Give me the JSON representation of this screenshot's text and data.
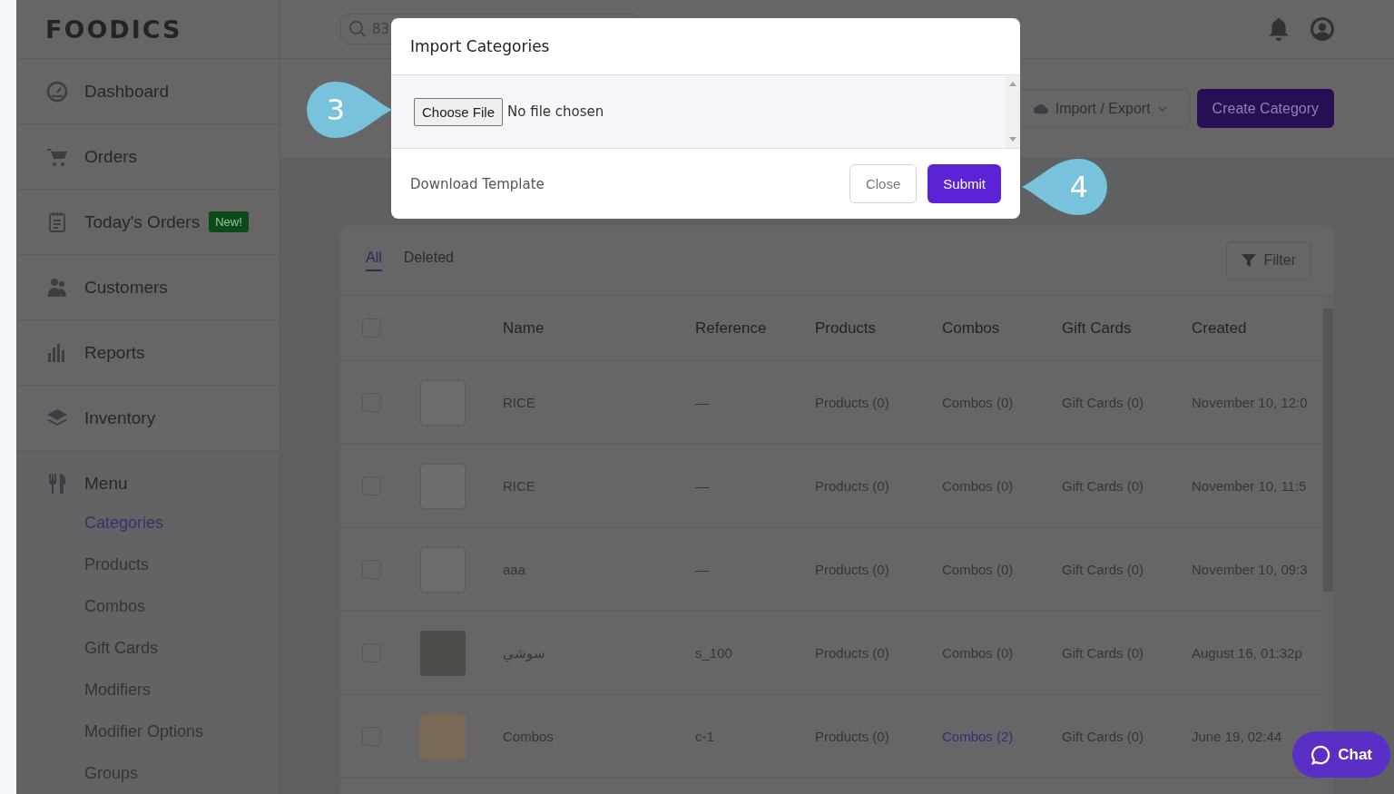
{
  "header": {
    "logo": "FOODICS",
    "search": {
      "value": "83"
    }
  },
  "sidebar": {
    "items": [
      {
        "kind": "dashboard",
        "label": "Dashboard"
      },
      {
        "kind": "orders",
        "label": "Orders"
      },
      {
        "kind": "today",
        "label": "Today's Orders",
        "badge": "New!"
      },
      {
        "kind": "customers",
        "label": "Customers"
      },
      {
        "kind": "reports",
        "label": "Reports"
      },
      {
        "kind": "inventory",
        "label": "Inventory"
      }
    ],
    "menu": {
      "label": "Menu",
      "children": [
        {
          "label": "Categories",
          "selected": true
        },
        {
          "label": "Products",
          "selected": false
        },
        {
          "label": "Combos",
          "selected": false
        },
        {
          "label": "Gift Cards",
          "selected": false
        },
        {
          "label": "Modifiers",
          "selected": false
        },
        {
          "label": "Modifier Options",
          "selected": false
        },
        {
          "label": "Groups",
          "selected": false
        }
      ]
    }
  },
  "toolbar": {
    "import_export": "Import / Export",
    "create": "Create Category"
  },
  "tabs": [
    {
      "label": "All",
      "selected": true
    },
    {
      "label": "Deleted",
      "selected": false
    }
  ],
  "filter": "Filter",
  "table": {
    "select_all": {
      "checked": false
    },
    "columns": [
      "Name",
      "Reference",
      "Products",
      "Combos",
      "Gift Cards",
      "Created"
    ],
    "rows": [
      {
        "checked": false,
        "photo": false,
        "name": "RICE",
        "reference": "—",
        "products": {
          "text": "Products (0)",
          "active": false
        },
        "combos": {
          "text": "Combos (0)",
          "active": false
        },
        "gift_cards": {
          "text": "Gift Cards (0)",
          "active": false
        },
        "created": "November 10, 12:0"
      },
      {
        "checked": false,
        "photo": false,
        "name": "RICE",
        "reference": "—",
        "products": {
          "text": "Products (0)",
          "active": false
        },
        "combos": {
          "text": "Combos (0)",
          "active": false
        },
        "gift_cards": {
          "text": "Gift Cards (0)",
          "active": false
        },
        "created": "November 10, 11:5"
      },
      {
        "checked": false,
        "photo": false,
        "name": "aaa",
        "reference": "—",
        "products": {
          "text": "Products (0)",
          "active": false
        },
        "combos": {
          "text": "Combos (0)",
          "active": false
        },
        "gift_cards": {
          "text": "Gift Cards (0)",
          "active": false
        },
        "created": "November 10, 09:3"
      },
      {
        "checked": false,
        "photo": true,
        "name": "سوشي",
        "reference": "s_100",
        "products": {
          "text": "Products (0)",
          "active": false
        },
        "combos": {
          "text": "Combos (0)",
          "active": false
        },
        "gift_cards": {
          "text": "Gift Cards (0)",
          "active": false
        },
        "created": "August 16, 01:32p"
      },
      {
        "checked": false,
        "photo": true,
        "name": "Combos",
        "reference": "c-1",
        "products": {
          "text": "Products (0)",
          "active": false
        },
        "combos": {
          "text": "Combos (2)",
          "active": true
        },
        "gift_cards": {
          "text": "Gift Cards (0)",
          "active": false
        },
        "created": "June 19, 02:44"
      }
    ]
  },
  "modal": {
    "title": "Import Categories",
    "file_button": "Choose File",
    "file_status": "No file chosen",
    "download": "Download Template",
    "close": "Close",
    "submit": "Submit"
  },
  "callouts": [
    {
      "number": "3",
      "kind": "right"
    },
    {
      "number": "4",
      "kind": "left"
    }
  ],
  "chat": "Chat"
}
